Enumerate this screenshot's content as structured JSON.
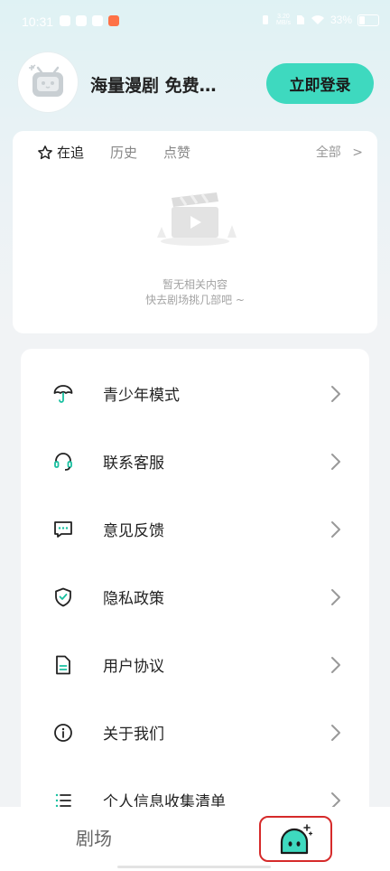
{
  "status_bar": {
    "time": "10:31",
    "speed_top": "3.20",
    "speed_bottom": "MB/s",
    "battery": "33%"
  },
  "profile": {
    "username": "海量漫剧 免费…",
    "login_button": "立即登录"
  },
  "follow_card": {
    "tabs": [
      {
        "label": "在追",
        "active": true
      },
      {
        "label": "历史",
        "active": false
      },
      {
        "label": "点赞",
        "active": false
      }
    ],
    "all_link": "全部",
    "empty_line1": "暂无相关内容",
    "empty_line2": "快去剧场挑几部吧 ~"
  },
  "menu": {
    "items": [
      {
        "label": "青少年模式",
        "icon": "umbrella-icon"
      },
      {
        "label": "联系客服",
        "icon": "headset-icon"
      },
      {
        "label": "意见反馈",
        "icon": "feedback-icon"
      },
      {
        "label": "隐私政策",
        "icon": "shield-check-icon"
      },
      {
        "label": "用户协议",
        "icon": "document-icon"
      },
      {
        "label": "关于我们",
        "icon": "info-icon"
      },
      {
        "label": "个人信息收集清单",
        "icon": "list-icon"
      }
    ]
  },
  "bottom_nav": {
    "theater_label": "剧场"
  },
  "colors": {
    "accent": "#3ed9bf",
    "icon_teal": "#18c0a0",
    "highlight_box": "#d62a2a"
  }
}
